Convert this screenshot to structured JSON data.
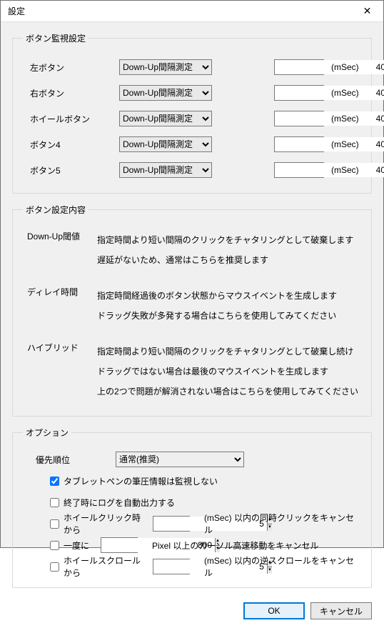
{
  "title": "設定",
  "group1": {
    "legend": "ボタン監視設定",
    "unit": "(mSec)",
    "rows": [
      {
        "label": "左ボタン",
        "mode": "Down-Up間隔測定",
        "value": "40"
      },
      {
        "label": "右ボタン",
        "mode": "Down-Up間隔測定",
        "value": "40"
      },
      {
        "label": "ホイールボタン",
        "mode": "Down-Up間隔測定",
        "value": "40"
      },
      {
        "label": "ボタン4",
        "mode": "Down-Up間隔測定",
        "value": "40"
      },
      {
        "label": "ボタン5",
        "mode": "Down-Up間隔測定",
        "value": "40"
      }
    ]
  },
  "group2": {
    "legend": "ボタン設定内容",
    "items": [
      {
        "label": "Down-Up閾値",
        "lines": [
          "指定時間より短い間隔のクリックをチャタリングとして破棄します",
          "遅延がないため、通常はこちらを推奨します"
        ]
      },
      {
        "label": "ディレイ時間",
        "lines": [
          "指定時間経過後のボタン状態からマウスイベントを生成します",
          "ドラッグ失敗が多発する場合はこちらを使用してみてください"
        ]
      },
      {
        "label": "ハイブリッド",
        "lines": [
          "指定時間より短い間隔のクリックをチャタリングとして破棄し続け",
          "ドラッグではない場合は最後のマウスイベントを生成します",
          "上の2つで問題が解消されない場合はこちらを使用してみてください"
        ]
      }
    ]
  },
  "group3": {
    "legend": "オプション",
    "priority_label": "優先順位",
    "priority_value": "通常(推奨)",
    "checks": {
      "tablet": {
        "checked": true,
        "text": "タブレットペンの筆圧情報は監視しない"
      },
      "log": {
        "checked": false,
        "text": "終了時にログを自動出力する"
      },
      "wheel_click": {
        "checked": false,
        "pre": "ホイールクリック時から",
        "value": "5",
        "post": "(mSec) 以内の同時クリックをキャンセル"
      },
      "once": {
        "checked": false,
        "pre": "一度に",
        "value": "800",
        "post": "Pixel 以上のカーソル高速移動をキャンセル"
      },
      "wheel_scroll": {
        "checked": false,
        "pre": "ホイールスクロールから",
        "value": "5",
        "post": "(mSec) 以内の逆スクロールをキャンセル"
      }
    }
  },
  "buttons": {
    "ok": "OK",
    "cancel": "キャンセル"
  }
}
